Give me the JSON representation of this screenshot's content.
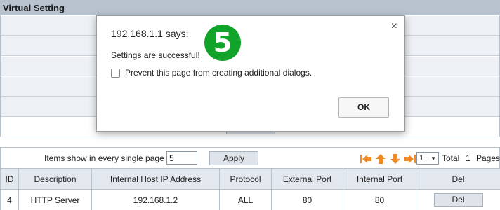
{
  "section": {
    "title": "Virtual Setting"
  },
  "pager": {
    "items_label": "Items show in every single page",
    "items_value": "5",
    "apply_label": "Apply",
    "page_select_value": "1",
    "total_label": "Total",
    "total_count": "1",
    "pages_label": "Pages"
  },
  "table": {
    "headers": [
      "ID",
      "Description",
      "Internal Host IP Address",
      "Protocol",
      "External Port",
      "Internal Port",
      "Del"
    ],
    "rows": [
      {
        "id": "4",
        "description": "HTTP Server",
        "ip": "192.168.1.2",
        "protocol": "ALL",
        "external_port": "80",
        "internal_port": "80",
        "del_label": "Del"
      }
    ]
  },
  "dialog": {
    "title": "192.168.1.1 says:",
    "message": "Settings are successful!",
    "checkbox_label": "Prevent this page from creating additional dialogs.",
    "ok_label": "OK",
    "close_glyph": "×"
  },
  "step_badge": {
    "number": "5",
    "color": "#12a32a"
  },
  "colors": {
    "header_bg": "#b9c3cf",
    "row_stripe": "#edf0f4",
    "arrow_orange": "#f08a24"
  },
  "icons": [
    "first-page-icon",
    "prev-page-icon",
    "next-page-icon",
    "last-page-icon",
    "close-icon",
    "chevron-down-icon"
  ]
}
